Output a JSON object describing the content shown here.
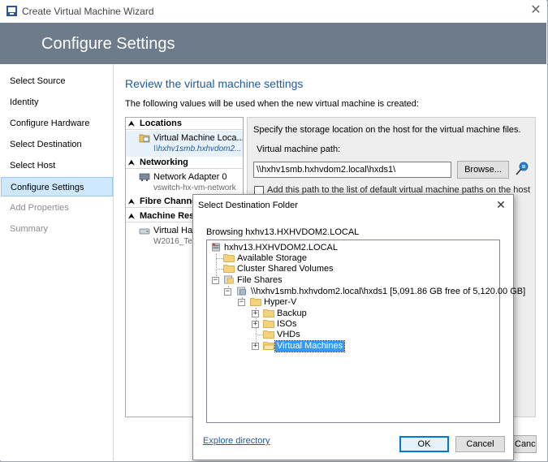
{
  "window": {
    "title": "Create Virtual Machine Wizard",
    "banner_title": "Configure Settings"
  },
  "nav": {
    "items": [
      {
        "label": "Select Source",
        "state": "enabled"
      },
      {
        "label": "Identity",
        "state": "enabled"
      },
      {
        "label": "Configure Hardware",
        "state": "enabled"
      },
      {
        "label": "Select Destination",
        "state": "enabled"
      },
      {
        "label": "Select Host",
        "state": "enabled"
      },
      {
        "label": "Configure Settings",
        "state": "selected"
      },
      {
        "label": "Add Properties",
        "state": "disabled"
      },
      {
        "label": "Summary",
        "state": "disabled"
      }
    ]
  },
  "content": {
    "title": "Review the virtual machine settings",
    "description": "The following values will be used when the new virtual machine is created:"
  },
  "summary_tree": {
    "sections": [
      {
        "header": "Locations",
        "items": [
          {
            "main": "Virtual Machine Loca...",
            "sub": "\\\\hxhv1smb.hxhvdom2..."
          }
        ]
      },
      {
        "header": "Networking",
        "items": [
          {
            "main": "Network Adapter 0",
            "sub": "vswitch-hx-vm-network"
          }
        ]
      },
      {
        "header": "Fibre Channe",
        "items": []
      },
      {
        "header": "Machine Res",
        "items": [
          {
            "main": "Virtual Har",
            "sub": "W2016_Te"
          }
        ]
      }
    ]
  },
  "detail": {
    "instruction": "Specify the storage location on the host for the virtual machine files.",
    "path_label": "Virtual machine path:",
    "path_value": "\\\\hxhv1smb.hxhvdom2.local\\hxds1\\",
    "browse_label": "Browse...",
    "add_path_label": "Add this path to the list of default virtual machine paths on the host",
    "add_path_checked": false
  },
  "main_cancel_label": "Cancel",
  "dialog": {
    "title": "Select Destination Folder",
    "browsing": "Browsing hxhv13.HXHVDOM2.LOCAL",
    "tree": [
      {
        "label": "hxhv13.HXHVDOM2.LOCAL",
        "level": 0,
        "icon": "server-icon"
      },
      {
        "label": "Available Storage",
        "level": 1,
        "icon": "folder-icon"
      },
      {
        "label": "Cluster Shared Volumes",
        "level": 1,
        "icon": "folder-icon"
      },
      {
        "label": "File Shares",
        "level": 1,
        "icon": "file-shares-icon",
        "expander": "-"
      },
      {
        "label": "\\\\hxhv1smb.hxhvdom2.local\\hxds1 [5,091.86 GB free of 5,120.00 GB]",
        "level": 2,
        "icon": "share-icon",
        "expander": "-"
      },
      {
        "label": "Hyper-V",
        "level": 3,
        "icon": "folder-icon",
        "expander": "-"
      },
      {
        "label": "Backup",
        "level": 4,
        "icon": "folder-icon",
        "expander": "+"
      },
      {
        "label": "ISOs",
        "level": 4,
        "icon": "folder-icon",
        "expander": "+"
      },
      {
        "label": "VHDs",
        "level": 4,
        "icon": "folder-icon"
      },
      {
        "label": "Virtual Machines",
        "level": 4,
        "icon": "folder-open-icon",
        "expander": "+",
        "selected": true
      }
    ],
    "explore_label": "Explore directory",
    "ok_label": "OK",
    "cancel_label": "Cancel"
  }
}
